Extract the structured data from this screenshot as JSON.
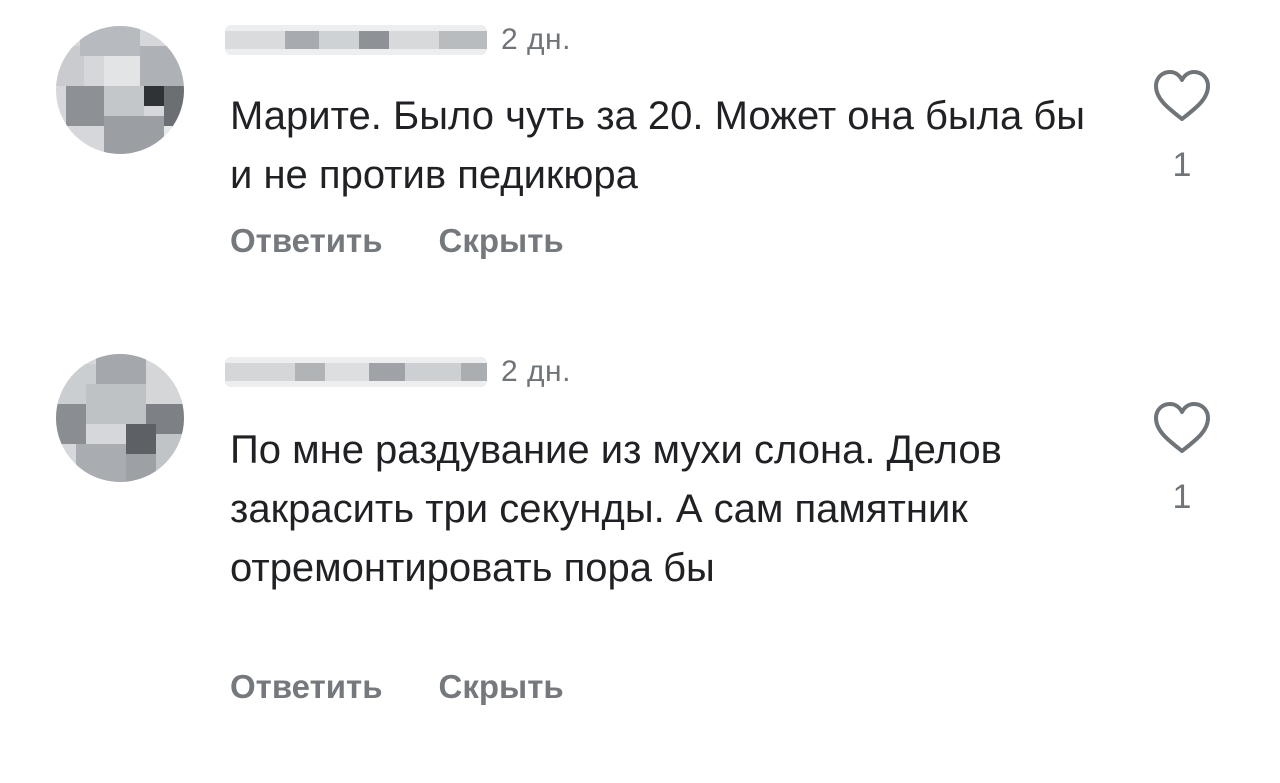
{
  "comments": [
    {
      "time": "2 дн.",
      "text": "Марите. Было чуть за 20. Может она была бы и не против педикюра",
      "reply_label": "Ответить",
      "hide_label": "Скрыть",
      "likes": "1"
    },
    {
      "time": "2 дн.",
      "text": "По мне раздувание из мухи слона. Делов закрасить три секунды. А сам памятник отремонтировать пора бы",
      "reply_label": "Ответить",
      "hide_label": "Скрыть",
      "likes": "1"
    }
  ],
  "icons": {
    "like": "heart-outline-icon"
  },
  "colors": {
    "text": "#1f2124",
    "secondary_text": "#6f7479",
    "action_text": "#75797e",
    "icon_stroke": "#6f7479",
    "background": "#ffffff"
  }
}
